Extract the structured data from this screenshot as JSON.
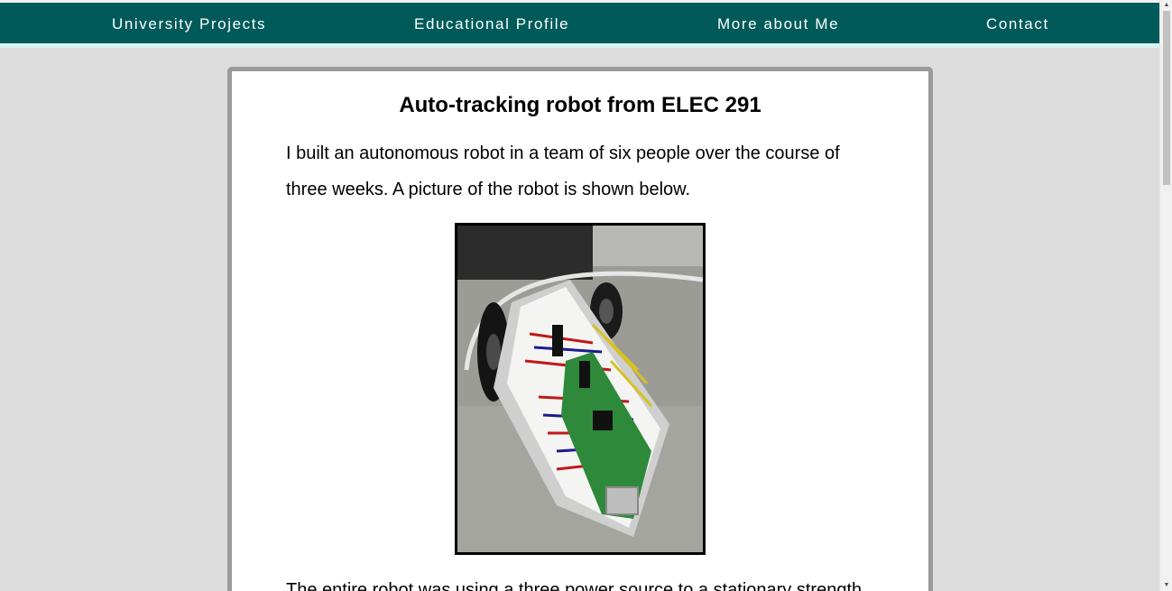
{
  "nav": {
    "items": [
      {
        "label": "University Projects"
      },
      {
        "label": "Educational Profile"
      },
      {
        "label": "More about Me"
      },
      {
        "label": "Contact"
      }
    ]
  },
  "main": {
    "title": "Auto-tracking robot from ELEC 291",
    "paragraph1": "I built an autonomous robot in a team of six people over the course of three weeks. A picture of the robot is shown below.",
    "paragraph2": "The entire robot was using a three power source to a stationary strength transmitter",
    "photo_icon": "robot-photo"
  },
  "scrollbar": {
    "up_glyph": "▲",
    "down_glyph": "▼"
  }
}
